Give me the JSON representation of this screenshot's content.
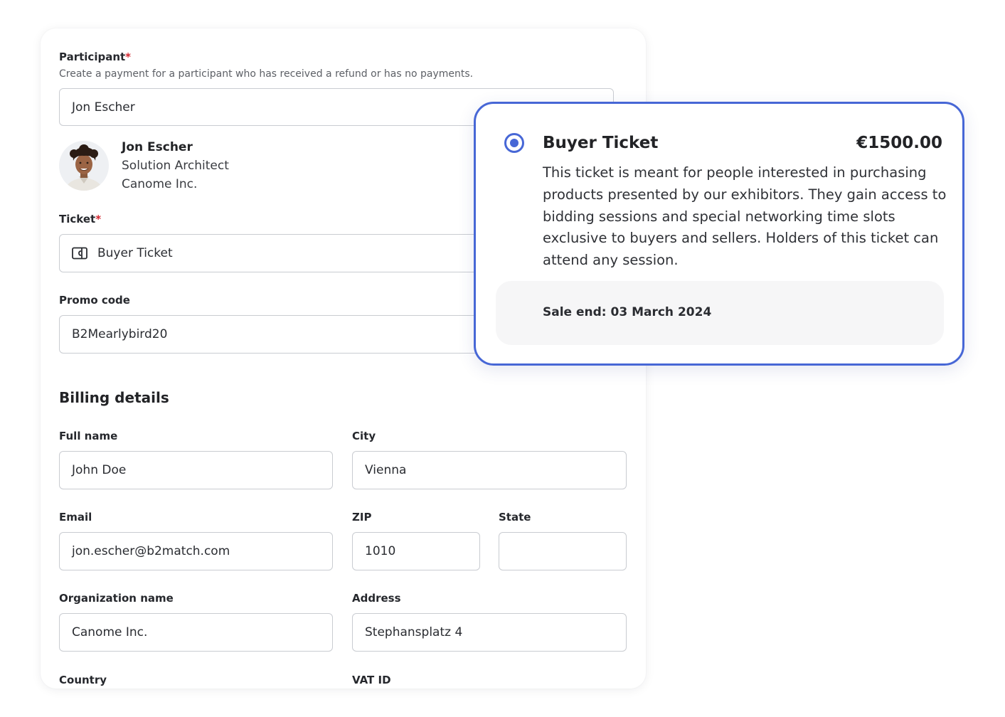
{
  "participant": {
    "label": "Participant",
    "required_mark": "*",
    "help_text": "Create a payment for a participant who has received a refund or has no payments.",
    "selected_value": "Jon Escher",
    "profile": {
      "name": "Jon Escher",
      "role": "Solution Architect",
      "company": "Canome Inc."
    }
  },
  "ticket": {
    "label": "Ticket",
    "required_mark": "*",
    "selected_value": "Buyer Ticket",
    "icon": "ticket-icon"
  },
  "promo": {
    "label": "Promo code",
    "value": "B2Mearlybird20"
  },
  "billing": {
    "title": "Billing details",
    "full_name_label": "Full name",
    "full_name_value": "John Doe",
    "city_label": "City",
    "city_value": "Vienna",
    "email_label": "Email",
    "email_value": "jon.escher@b2match.com",
    "zip_label": "ZIP",
    "zip_value": "1010",
    "state_label": "State",
    "state_value": "",
    "org_label": "Organization name",
    "org_value": "Canome Inc.",
    "address_label": "Address",
    "address_value": "Stephansplatz 4",
    "country_label": "Country",
    "vat_label": "VAT ID"
  },
  "ticket_option": {
    "title": "Buyer Ticket",
    "price": "€1500.00",
    "description": "This ticket is meant for people interested in purchasing products presented by our exhibitors. They gain access to bidding sessions and special networking time slots exclusive to buyers and sellers. Holders of this ticket can attend any session.",
    "sale_end": "Sale end: 03 March 2024",
    "selected": true
  },
  "colors": {
    "accent": "#4767d6",
    "required": "#d3262f",
    "input_border": "#c9ccd1",
    "sale_bg": "#f6f6f7"
  }
}
